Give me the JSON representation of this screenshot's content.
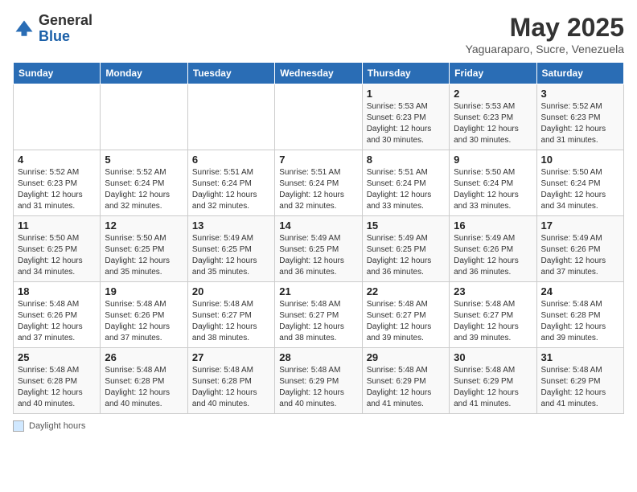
{
  "header": {
    "logo_general": "General",
    "logo_blue": "Blue",
    "month_title": "May 2025",
    "subtitle": "Yaguaraparo, Sucre, Venezuela"
  },
  "days_of_week": [
    "Sunday",
    "Monday",
    "Tuesday",
    "Wednesday",
    "Thursday",
    "Friday",
    "Saturday"
  ],
  "footer_label": "Daylight hours",
  "weeks": [
    [
      {
        "day": "",
        "info": ""
      },
      {
        "day": "",
        "info": ""
      },
      {
        "day": "",
        "info": ""
      },
      {
        "day": "",
        "info": ""
      },
      {
        "day": "1",
        "info": "Sunrise: 5:53 AM\nSunset: 6:23 PM\nDaylight: 12 hours\nand 30 minutes."
      },
      {
        "day": "2",
        "info": "Sunrise: 5:53 AM\nSunset: 6:23 PM\nDaylight: 12 hours\nand 30 minutes."
      },
      {
        "day": "3",
        "info": "Sunrise: 5:52 AM\nSunset: 6:23 PM\nDaylight: 12 hours\nand 31 minutes."
      }
    ],
    [
      {
        "day": "4",
        "info": "Sunrise: 5:52 AM\nSunset: 6:23 PM\nDaylight: 12 hours\nand 31 minutes."
      },
      {
        "day": "5",
        "info": "Sunrise: 5:52 AM\nSunset: 6:24 PM\nDaylight: 12 hours\nand 32 minutes."
      },
      {
        "day": "6",
        "info": "Sunrise: 5:51 AM\nSunset: 6:24 PM\nDaylight: 12 hours\nand 32 minutes."
      },
      {
        "day": "7",
        "info": "Sunrise: 5:51 AM\nSunset: 6:24 PM\nDaylight: 12 hours\nand 32 minutes."
      },
      {
        "day": "8",
        "info": "Sunrise: 5:51 AM\nSunset: 6:24 PM\nDaylight: 12 hours\nand 33 minutes."
      },
      {
        "day": "9",
        "info": "Sunrise: 5:50 AM\nSunset: 6:24 PM\nDaylight: 12 hours\nand 33 minutes."
      },
      {
        "day": "10",
        "info": "Sunrise: 5:50 AM\nSunset: 6:24 PM\nDaylight: 12 hours\nand 34 minutes."
      }
    ],
    [
      {
        "day": "11",
        "info": "Sunrise: 5:50 AM\nSunset: 6:25 PM\nDaylight: 12 hours\nand 34 minutes."
      },
      {
        "day": "12",
        "info": "Sunrise: 5:50 AM\nSunset: 6:25 PM\nDaylight: 12 hours\nand 35 minutes."
      },
      {
        "day": "13",
        "info": "Sunrise: 5:49 AM\nSunset: 6:25 PM\nDaylight: 12 hours\nand 35 minutes."
      },
      {
        "day": "14",
        "info": "Sunrise: 5:49 AM\nSunset: 6:25 PM\nDaylight: 12 hours\nand 36 minutes."
      },
      {
        "day": "15",
        "info": "Sunrise: 5:49 AM\nSunset: 6:25 PM\nDaylight: 12 hours\nand 36 minutes."
      },
      {
        "day": "16",
        "info": "Sunrise: 5:49 AM\nSunset: 6:26 PM\nDaylight: 12 hours\nand 36 minutes."
      },
      {
        "day": "17",
        "info": "Sunrise: 5:49 AM\nSunset: 6:26 PM\nDaylight: 12 hours\nand 37 minutes."
      }
    ],
    [
      {
        "day": "18",
        "info": "Sunrise: 5:48 AM\nSunset: 6:26 PM\nDaylight: 12 hours\nand 37 minutes."
      },
      {
        "day": "19",
        "info": "Sunrise: 5:48 AM\nSunset: 6:26 PM\nDaylight: 12 hours\nand 37 minutes."
      },
      {
        "day": "20",
        "info": "Sunrise: 5:48 AM\nSunset: 6:27 PM\nDaylight: 12 hours\nand 38 minutes."
      },
      {
        "day": "21",
        "info": "Sunrise: 5:48 AM\nSunset: 6:27 PM\nDaylight: 12 hours\nand 38 minutes."
      },
      {
        "day": "22",
        "info": "Sunrise: 5:48 AM\nSunset: 6:27 PM\nDaylight: 12 hours\nand 39 minutes."
      },
      {
        "day": "23",
        "info": "Sunrise: 5:48 AM\nSunset: 6:27 PM\nDaylight: 12 hours\nand 39 minutes."
      },
      {
        "day": "24",
        "info": "Sunrise: 5:48 AM\nSunset: 6:28 PM\nDaylight: 12 hours\nand 39 minutes."
      }
    ],
    [
      {
        "day": "25",
        "info": "Sunrise: 5:48 AM\nSunset: 6:28 PM\nDaylight: 12 hours\nand 40 minutes."
      },
      {
        "day": "26",
        "info": "Sunrise: 5:48 AM\nSunset: 6:28 PM\nDaylight: 12 hours\nand 40 minutes."
      },
      {
        "day": "27",
        "info": "Sunrise: 5:48 AM\nSunset: 6:28 PM\nDaylight: 12 hours\nand 40 minutes."
      },
      {
        "day": "28",
        "info": "Sunrise: 5:48 AM\nSunset: 6:29 PM\nDaylight: 12 hours\nand 40 minutes."
      },
      {
        "day": "29",
        "info": "Sunrise: 5:48 AM\nSunset: 6:29 PM\nDaylight: 12 hours\nand 41 minutes."
      },
      {
        "day": "30",
        "info": "Sunrise: 5:48 AM\nSunset: 6:29 PM\nDaylight: 12 hours\nand 41 minutes."
      },
      {
        "day": "31",
        "info": "Sunrise: 5:48 AM\nSunset: 6:29 PM\nDaylight: 12 hours\nand 41 minutes."
      }
    ]
  ]
}
